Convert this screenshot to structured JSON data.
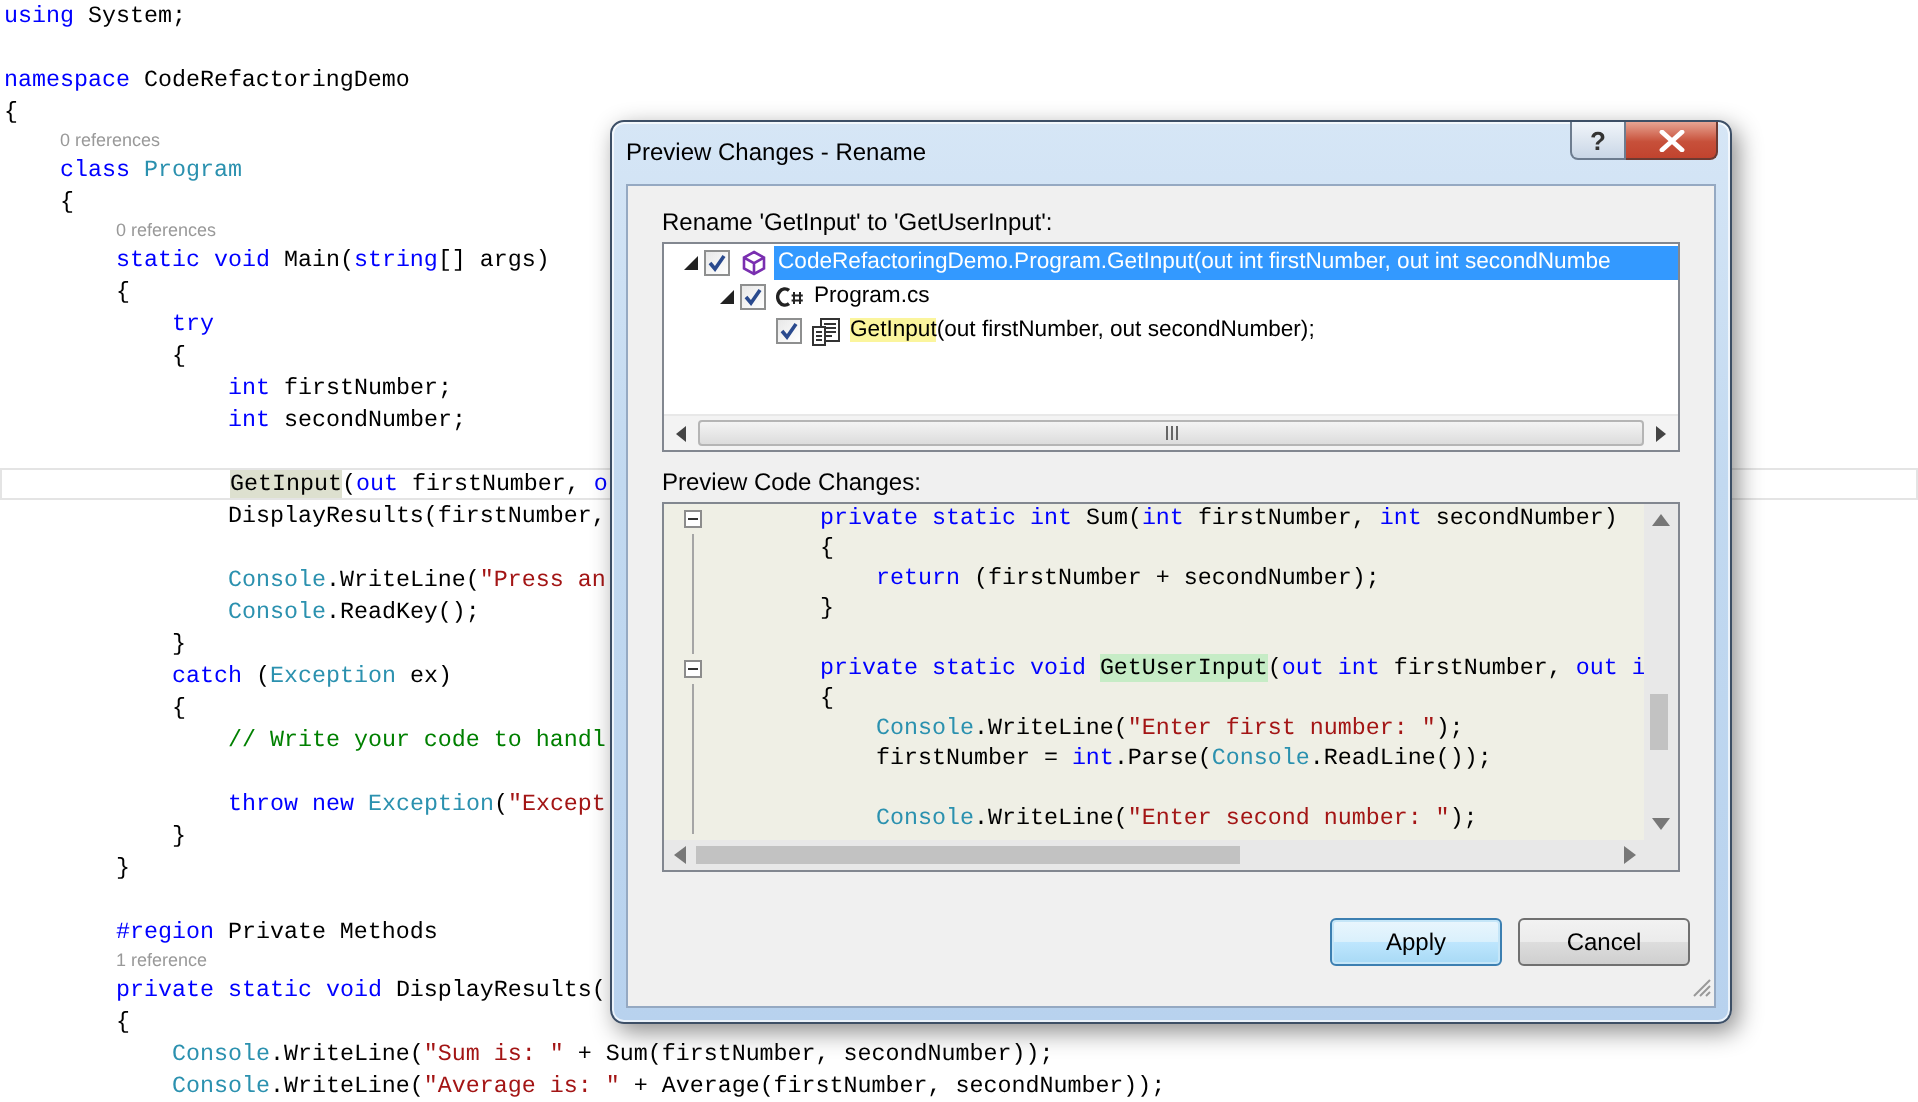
{
  "editor": {
    "lines": [
      {
        "kind": "code",
        "current": false,
        "tokens": [
          {
            "kind": "keyword",
            "text": "using"
          },
          {
            "kind": "plain",
            "text": " System;"
          }
        ]
      },
      {
        "kind": "blank"
      },
      {
        "kind": "code",
        "current": false,
        "tokens": [
          {
            "kind": "keyword",
            "text": "namespace"
          },
          {
            "kind": "plain",
            "text": " CodeRefactoringDemo"
          }
        ]
      },
      {
        "kind": "code",
        "current": false,
        "tokens": [
          {
            "kind": "plain",
            "text": "{"
          }
        ]
      },
      {
        "kind": "lens",
        "text": "0 references"
      },
      {
        "kind": "code",
        "current": false,
        "tokens": [
          {
            "kind": "keyword",
            "text": "    class"
          },
          {
            "kind": "type",
            "text": " Program"
          }
        ]
      },
      {
        "kind": "code",
        "current": false,
        "tokens": [
          {
            "kind": "plain",
            "text": "    {"
          }
        ]
      },
      {
        "kind": "lens",
        "text": "0 references"
      },
      {
        "kind": "code",
        "current": false,
        "tokens": [
          {
            "kind": "keyword",
            "text": "        static"
          },
          {
            "kind": "keyword",
            "text": " void"
          },
          {
            "kind": "plain",
            "text": " Main("
          },
          {
            "kind": "keyword",
            "text": "string"
          },
          {
            "kind": "plain",
            "text": "[] args)"
          }
        ]
      },
      {
        "kind": "code",
        "current": false,
        "tokens": [
          {
            "kind": "plain",
            "text": "        {"
          }
        ]
      },
      {
        "kind": "code",
        "current": false,
        "tokens": [
          {
            "kind": "keyword",
            "text": "            try"
          }
        ]
      },
      {
        "kind": "code",
        "current": false,
        "tokens": [
          {
            "kind": "plain",
            "text": "            {"
          }
        ]
      },
      {
        "kind": "code",
        "current": false,
        "tokens": [
          {
            "kind": "keyword",
            "text": "                int"
          },
          {
            "kind": "plain",
            "text": " firstNumber;"
          }
        ]
      },
      {
        "kind": "code",
        "current": false,
        "tokens": [
          {
            "kind": "keyword",
            "text": "                int"
          },
          {
            "kind": "plain",
            "text": " secondNumber;"
          }
        ]
      },
      {
        "kind": "blank"
      },
      {
        "kind": "code",
        "current": true,
        "tokens": [
          {
            "kind": "reference",
            "text": "                GetInput"
          },
          {
            "kind": "plain",
            "text": "("
          },
          {
            "kind": "keyword",
            "text": "out"
          },
          {
            "kind": "plain",
            "text": " firstNumber,"
          },
          {
            "kind": "keyword",
            "text": " o"
          }
        ]
      },
      {
        "kind": "code",
        "current": false,
        "tokens": [
          {
            "kind": "plain",
            "text": "                DisplayResults(firstNumber,"
          }
        ]
      },
      {
        "kind": "blank"
      },
      {
        "kind": "code",
        "current": false,
        "tokens": [
          {
            "kind": "type",
            "text": "                Console"
          },
          {
            "kind": "plain",
            "text": ".WriteLine("
          },
          {
            "kind": "string",
            "text": "\"Press an"
          }
        ]
      },
      {
        "kind": "code",
        "current": false,
        "tokens": [
          {
            "kind": "type",
            "text": "                Console"
          },
          {
            "kind": "plain",
            "text": ".ReadKey();"
          }
        ]
      },
      {
        "kind": "code",
        "current": false,
        "tokens": [
          {
            "kind": "plain",
            "text": "            }"
          }
        ]
      },
      {
        "kind": "code",
        "current": false,
        "tokens": [
          {
            "kind": "keyword",
            "text": "            catch"
          },
          {
            "kind": "plain",
            "text": " ("
          },
          {
            "kind": "type",
            "text": "Exception"
          },
          {
            "kind": "plain",
            "text": " ex)"
          }
        ]
      },
      {
        "kind": "code",
        "current": false,
        "tokens": [
          {
            "kind": "plain",
            "text": "            {"
          }
        ]
      },
      {
        "kind": "code",
        "current": false,
        "tokens": [
          {
            "kind": "comment",
            "text": "                // Write your code to handl"
          }
        ]
      },
      {
        "kind": "blank"
      },
      {
        "kind": "code",
        "current": false,
        "tokens": [
          {
            "kind": "keyword",
            "text": "                throw"
          },
          {
            "kind": "keyword",
            "text": " new"
          },
          {
            "kind": "type",
            "text": " Exception"
          },
          {
            "kind": "plain",
            "text": "("
          },
          {
            "kind": "string",
            "text": "\"Except"
          }
        ]
      },
      {
        "kind": "code",
        "current": false,
        "tokens": [
          {
            "kind": "plain",
            "text": "            }"
          }
        ]
      },
      {
        "kind": "code",
        "current": false,
        "tokens": [
          {
            "kind": "plain",
            "text": "        }"
          }
        ]
      },
      {
        "kind": "blank"
      },
      {
        "kind": "code",
        "current": false,
        "tokens": [
          {
            "kind": "keyword",
            "text": "        #region"
          },
          {
            "kind": "plain",
            "text": " Private Methods"
          }
        ]
      },
      {
        "kind": "lens",
        "text": "1 reference"
      },
      {
        "kind": "code",
        "current": false,
        "tokens": [
          {
            "kind": "keyword",
            "text": "        private"
          },
          {
            "kind": "keyword",
            "text": " static"
          },
          {
            "kind": "keyword",
            "text": " void"
          },
          {
            "kind": "plain",
            "text": " DisplayResults("
          }
        ]
      },
      {
        "kind": "code",
        "current": false,
        "tokens": [
          {
            "kind": "plain",
            "text": "        {"
          }
        ]
      },
      {
        "kind": "code",
        "current": false,
        "tokens": [
          {
            "kind": "type",
            "text": "            Console"
          },
          {
            "kind": "plain",
            "text": ".WriteLine("
          },
          {
            "kind": "string",
            "text": "\"Sum is: \""
          },
          {
            "kind": "plain",
            "text": " + Sum(firstNumber, secondNumber));"
          }
        ]
      },
      {
        "kind": "code",
        "current": false,
        "tokens": [
          {
            "kind": "type",
            "text": "            Console"
          },
          {
            "kind": "plain",
            "text": ".WriteLine("
          },
          {
            "kind": "string",
            "text": "\"Average is: \""
          },
          {
            "kind": "plain",
            "text": " + Average(firstNumber, secondNumber));"
          }
        ]
      }
    ]
  },
  "dialog": {
    "title": "Preview Changes - Rename",
    "help_button": "?",
    "rename_label": "Rename 'GetInput' to 'GetUserInput':",
    "tree": [
      {
        "kind": "method",
        "label": "CodeRefactoringDemo.Program.GetInput(out int firstNumber, out int secondNumbe",
        "checked": true,
        "selected": true,
        "expanded": true,
        "children": [
          {
            "kind": "file",
            "label": "Program.cs",
            "checked": true,
            "selected": false,
            "expanded": true,
            "children": [
              {
                "kind": "reference",
                "match": "GetInput",
                "label": "(out firstNumber, out secondNumber);",
                "checked": true,
                "selected": false
              }
            ]
          }
        ]
      }
    ],
    "preview_label": "Preview Code Changes:",
    "preview_lines": [
      {
        "collapsible": true,
        "tokens": [
          {
            "kind": "keyword",
            "text": "        private"
          },
          {
            "kind": "keyword",
            "text": " static"
          },
          {
            "kind": "keyword",
            "text": " int"
          },
          {
            "kind": "plain",
            "text": " Sum("
          },
          {
            "kind": "keyword",
            "text": "int"
          },
          {
            "kind": "plain",
            "text": " firstNumber,"
          },
          {
            "kind": "keyword",
            "text": " int"
          },
          {
            "kind": "plain",
            "text": " secondNumber)"
          }
        ]
      },
      {
        "collapsible": false,
        "tokens": [
          {
            "kind": "plain",
            "text": "        {"
          }
        ]
      },
      {
        "collapsible": false,
        "tokens": [
          {
            "kind": "keyword",
            "text": "            return"
          },
          {
            "kind": "plain",
            "text": " (firstNumber + secondNumber);"
          }
        ]
      },
      {
        "collapsible": false,
        "tokens": [
          {
            "kind": "plain",
            "text": "        }"
          }
        ]
      },
      {
        "collapsible": false
      },
      {
        "collapsible": true,
        "tokens": [
          {
            "kind": "keyword",
            "text": "        private"
          },
          {
            "kind": "keyword",
            "text": " static"
          },
          {
            "kind": "keyword",
            "text": " void"
          },
          {
            "kind": "rename",
            "text": " GetUserInput"
          },
          {
            "kind": "plain",
            "text": "("
          },
          {
            "kind": "keyword",
            "text": "out"
          },
          {
            "kind": "keyword",
            "text": " int"
          },
          {
            "kind": "plain",
            "text": " firstNumber,"
          },
          {
            "kind": "keyword",
            "text": " out"
          },
          {
            "kind": "keyword",
            "text": " i"
          }
        ]
      },
      {
        "collapsible": false,
        "tokens": [
          {
            "kind": "plain",
            "text": "        {"
          }
        ]
      },
      {
        "collapsible": false,
        "tokens": [
          {
            "kind": "type",
            "text": "            Console"
          },
          {
            "kind": "plain",
            "text": ".WriteLine("
          },
          {
            "kind": "string",
            "text": "\"Enter first number: \""
          },
          {
            "kind": "plain",
            "text": ");"
          }
        ]
      },
      {
        "collapsible": false,
        "tokens": [
          {
            "kind": "plain",
            "text": "            firstNumber = "
          },
          {
            "kind": "keyword",
            "text": "int"
          },
          {
            "kind": "plain",
            "text": ".Parse("
          },
          {
            "kind": "type",
            "text": "Console"
          },
          {
            "kind": "plain",
            "text": ".ReadLine());"
          }
        ]
      },
      {
        "collapsible": false
      },
      {
        "collapsible": false,
        "tokens": [
          {
            "kind": "type",
            "text": "            Console"
          },
          {
            "kind": "plain",
            "text": ".WriteLine("
          },
          {
            "kind": "string",
            "text": "\"Enter second number: \""
          },
          {
            "kind": "plain",
            "text": ");"
          }
        ]
      }
    ],
    "buttons": [
      {
        "label": "Apply",
        "default": true
      },
      {
        "label": "Cancel",
        "default": false
      }
    ]
  }
}
